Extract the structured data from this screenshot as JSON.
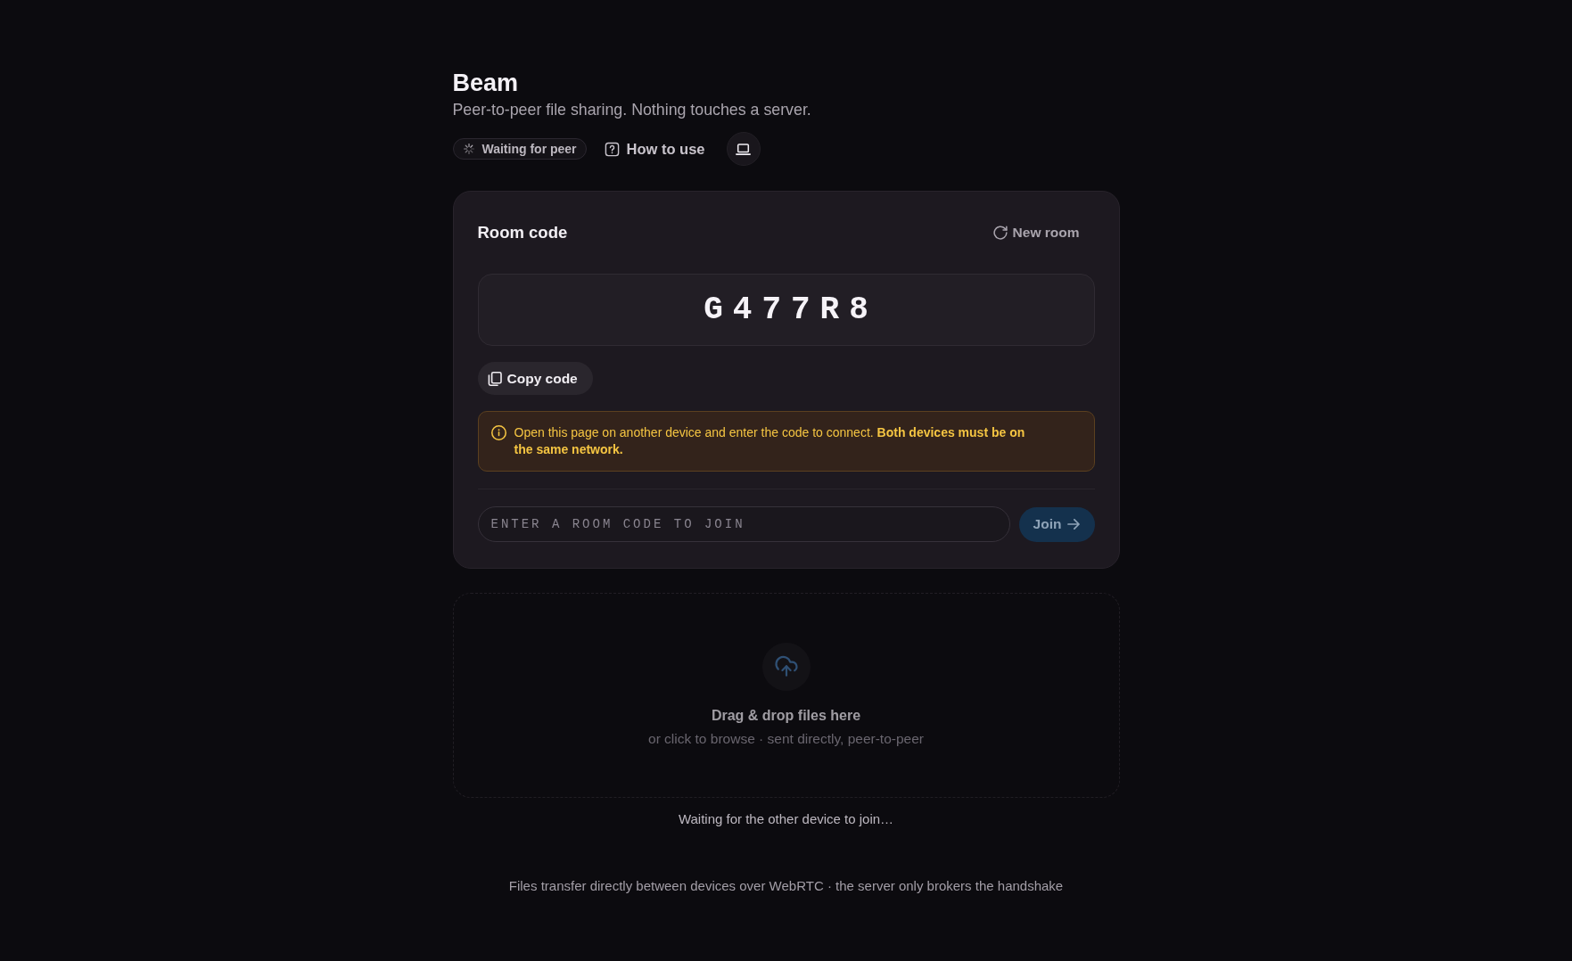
{
  "app": {
    "title": "Beam",
    "tagline": "Peer-to-peer file sharing. Nothing touches a server."
  },
  "toolbar": {
    "status": {
      "label": "Waiting for peer"
    },
    "help_link": {
      "label": "How to use"
    }
  },
  "room": {
    "title": "Room code",
    "new_room_button": "New room",
    "code": "G477R8",
    "copy_button": "Copy code",
    "notice": "Open this page on another device and enter the code to connect. **Both devices must be on the same network.**",
    "join": {
      "placeholder": "ENTER A ROOM CODE TO JOIN",
      "button": {
        "label": "Join",
        "disabled": true
      }
    }
  },
  "drop_zone": {
    "title": "Drag & drop files here",
    "subtitle": "or click to browse · sent directly, peer-to-peer",
    "disabled": true
  },
  "status_message": "Waiting for the other device to join…",
  "footer": "Files transfer directly between devices over WebRTC · the server only brokers the handshake"
}
